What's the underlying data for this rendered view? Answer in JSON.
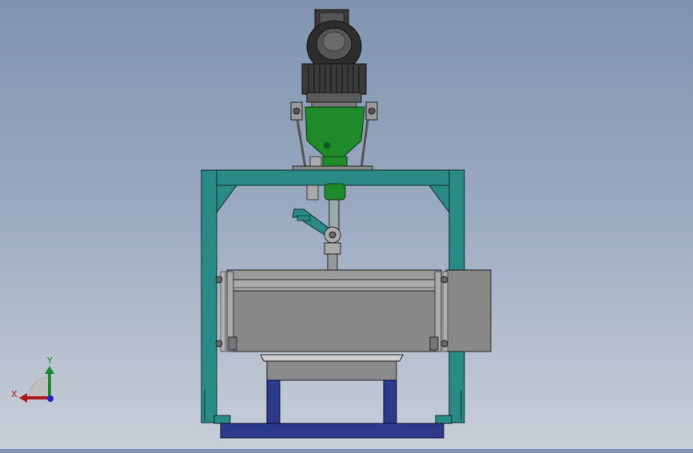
{
  "viewport": {
    "background_top": "#7f93b0",
    "background_bottom": "#c9cfd8"
  },
  "triad": {
    "x_label": "X",
    "y_label": "Y",
    "x_color": "#b01818",
    "y_color": "#1a8a2a",
    "z_color": "#1a2ad0"
  },
  "colors": {
    "frame": "#2a8a86",
    "motor_green": "#1e8a2a",
    "base_blue": "#2c3a8a",
    "tank_gray": "#888888",
    "motor_dark": "#2a2a2a"
  }
}
